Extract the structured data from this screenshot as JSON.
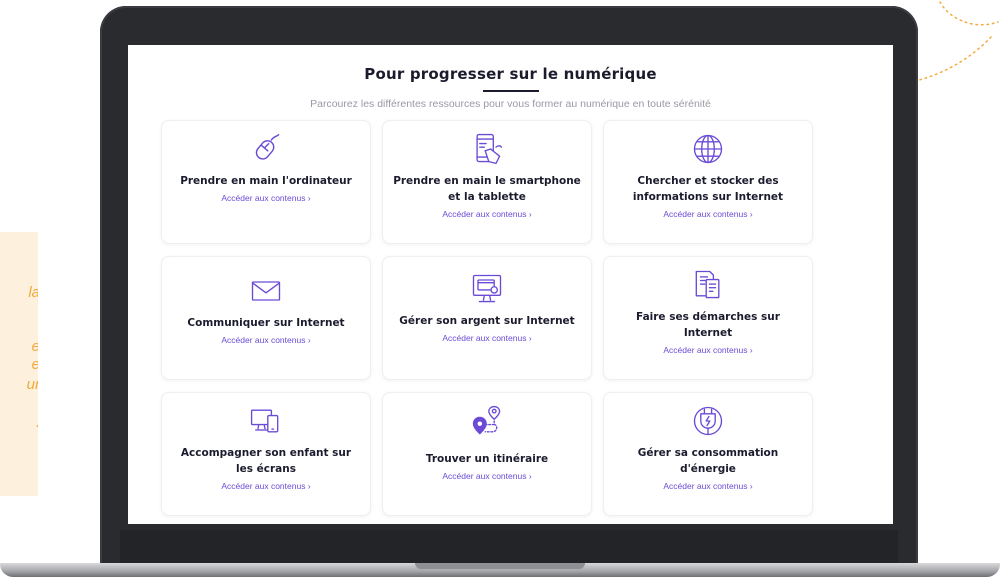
{
  "left_panel": {
    "quote_fragments": [
      "la",
      "e",
      "e",
      "ur",
      "."
    ]
  },
  "screen": {
    "title": "Pour progresser sur le numérique",
    "subtitle": "Parcourez les différentes ressources pour vous former au numérique en toute sérénité",
    "cards": [
      {
        "title": "Prendre en main l'ordinateur",
        "link": "Accéder aux contenus",
        "icon": "mouse-icon"
      },
      {
        "title": "Prendre en main le smartphone et la tablette",
        "link": "Accéder aux contenus",
        "icon": "smartphone-icon"
      },
      {
        "title": "Chercher et stocker des informations sur Internet",
        "link": "Accéder aux contenus",
        "icon": "globe-icon"
      },
      {
        "title": "Communiquer sur Internet",
        "link": "Accéder aux contenus",
        "icon": "envelope-icon"
      },
      {
        "title": "Gérer son argent sur Internet",
        "link": "Accéder aux contenus",
        "icon": "monitor-card-icon"
      },
      {
        "title": "Faire ses démarches sur Internet",
        "link": "Accéder aux contenus",
        "icon": "documents-icon"
      },
      {
        "title": "Accompagner son enfant sur les écrans",
        "link": "Accéder aux contenus",
        "icon": "devices-icon"
      },
      {
        "title": "Trouver un itinéraire",
        "link": "Accéder aux contenus",
        "icon": "route-pin-icon"
      },
      {
        "title": "Gérer sa consommation d'énergie",
        "link": "Accéder aux contenus",
        "icon": "plug-icon"
      }
    ]
  },
  "colors": {
    "accent": "#6b4bd6",
    "quote_text": "#f4a93c",
    "quote_bg": "#fdf0dc",
    "laptop": "#2a2b2f"
  }
}
